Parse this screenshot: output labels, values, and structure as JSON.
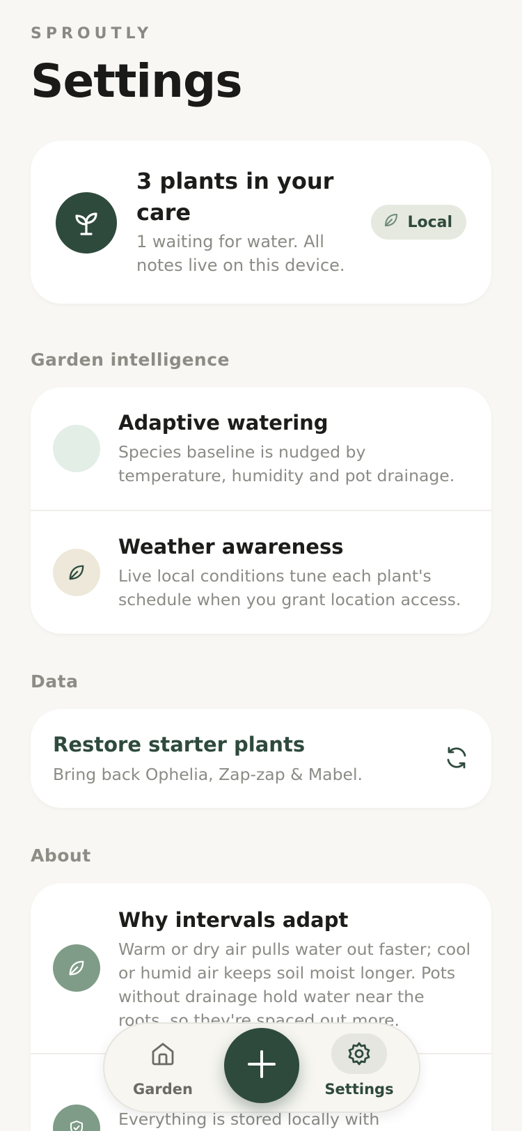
{
  "app": {
    "brand": "SPROUTLY",
    "page_title": "Settings"
  },
  "summary": {
    "title": "3 plants in your care",
    "subtitle": "1 waiting for water. All notes live on this device.",
    "badge": "Local",
    "icon": "sprout-icon"
  },
  "sections": {
    "garden_intelligence": {
      "label": "Garden intelligence",
      "items": [
        {
          "title": "Adaptive watering",
          "description": "Species baseline is nudged by temperature, humidity and pot drainage.",
          "icon": "blank"
        },
        {
          "title": "Weather awareness",
          "description": "Live local conditions tune each plant's schedule when you grant location access.",
          "icon": "leaf-icon"
        }
      ]
    },
    "data": {
      "label": "Data",
      "restore": {
        "title": "Restore starter plants",
        "description": "Bring back Ophelia, Zap-zap & Mabel.",
        "icon": "refresh-icon"
      }
    },
    "about": {
      "label": "About",
      "items": [
        {
          "title": "Why intervals adapt",
          "description": "Warm or dry air pulls water out faster; cool or humid air keeps soil moist longer. Pots without drainage hold water near the roots, so they're spaced out more.",
          "icon": "leaf-icon"
        },
        {
          "title": "",
          "description": "Everything is stored locally with",
          "icon": "shield-icon"
        }
      ]
    }
  },
  "tabbar": {
    "tabs": [
      {
        "label": "Garden",
        "icon": "home-icon",
        "active": false
      },
      {
        "label": "Settings",
        "icon": "gear-icon",
        "active": true
      }
    ],
    "fab_icon": "plus-icon"
  },
  "colors": {
    "accent": "#2e4a3d",
    "background": "#f8f7f3",
    "muted_text": "#8b8b86"
  }
}
